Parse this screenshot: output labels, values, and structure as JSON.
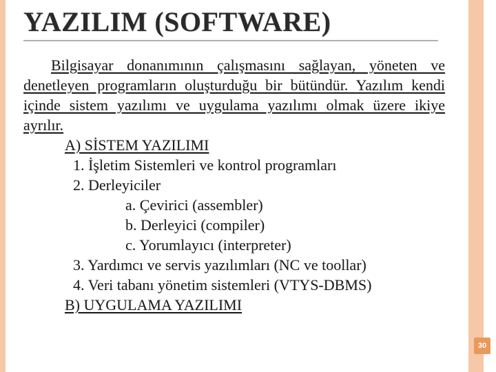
{
  "title": "YAZILIM (SOFTWARE)",
  "intro": "Bilgisayar donanımının çalışmasını sağlayan, yöneten ve denetleyen programların oluşturduğu bir bütündür. Yazılım kendi içinde sistem yazılımı ve uygulama yazılımı olmak üzere ikiye ayrılır.",
  "section_a": "A) SİSTEM YAZILIMI",
  "items": {
    "i1": "1. İşletim Sistemleri ve kontrol programları",
    "i2": "2. Derleyiciler",
    "i2a": "a. Çevirici (assembler)",
    "i2b": "b. Derleyici (compiler)",
    "i2c": "c. Yorumlayıcı (interpreter)",
    "i3": "3. Yardımcı ve servis yazılımları (NC ve toollar)",
    "i4": "4. Veri tabanı yönetim sistemleri (VTYS-DBMS)"
  },
  "section_b": "B) UYGULAMA YAZILIMI",
  "page_number": "30"
}
